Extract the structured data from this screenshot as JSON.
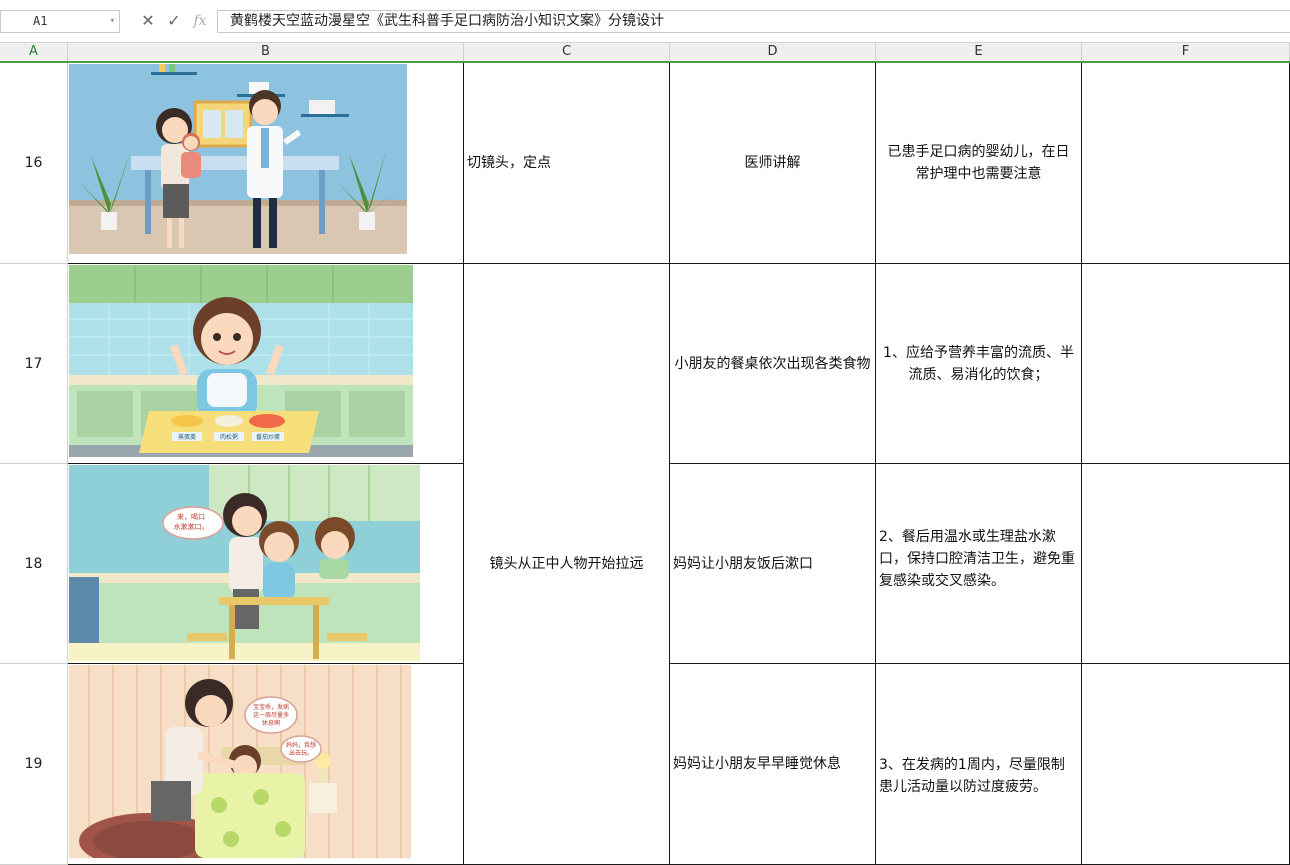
{
  "formula_bar": {
    "name_box": "A1",
    "cancel_icon": "close-icon",
    "confirm_icon": "check-icon",
    "fx_label": "fx",
    "content": "黄鹤楼天空蓝动漫星空《武生科普手足口病防治小知识文案》分镜设计"
  },
  "columns": [
    "A",
    "B",
    "C",
    "D",
    "E",
    "F"
  ],
  "rows": [
    {
      "num": "16",
      "image": "doctor-consultation-illustration",
      "camera": "切镜头，定点",
      "scene": "医师讲解",
      "narration": "已患手足口病的婴幼儿，在日常护理中也需要注意",
      "note": ""
    },
    {
      "num": "17",
      "image": "child-eating-meal-illustration",
      "camera": "镜头从正中人物开始拉远",
      "scene": "小朋友的餐桌依次出现各类食物",
      "narration": "1、应给予营养丰富的流质、半流质、易消化的饮食；",
      "note": ""
    },
    {
      "num": "18",
      "image": "mother-child-rinse-mouth-illustration",
      "camera": "",
      "scene": "妈妈让小朋友饭后漱口",
      "narration": "2、餐后用温水或生理盐水漱口，保持口腔清洁卫生，避免重复感染或交叉感染。",
      "note": ""
    },
    {
      "num": "19",
      "image": "child-resting-in-bed-illustration",
      "camera": "",
      "scene": "妈妈让小朋友早早睡觉休息",
      "narration": "3、在发病的1周内，尽量限制患儿活动量以防过度疲劳。",
      "note": ""
    }
  ],
  "illustration_text": {
    "food_labels": [
      "蒸蛋羹",
      "肉松粥",
      "番茄炒蛋"
    ],
    "bubble_rinse": [
      "来，喝口",
      "水漱漱口。"
    ],
    "bubble_rest_mom": [
      "宝宝乖，发病",
      "这一周尽量多",
      "休息啊"
    ],
    "bubble_rest_child": [
      "妈妈，我想",
      "出去玩。"
    ]
  },
  "colors": {
    "grid_border": "#1a1a1a",
    "header_accent": "#4aa04a"
  }
}
